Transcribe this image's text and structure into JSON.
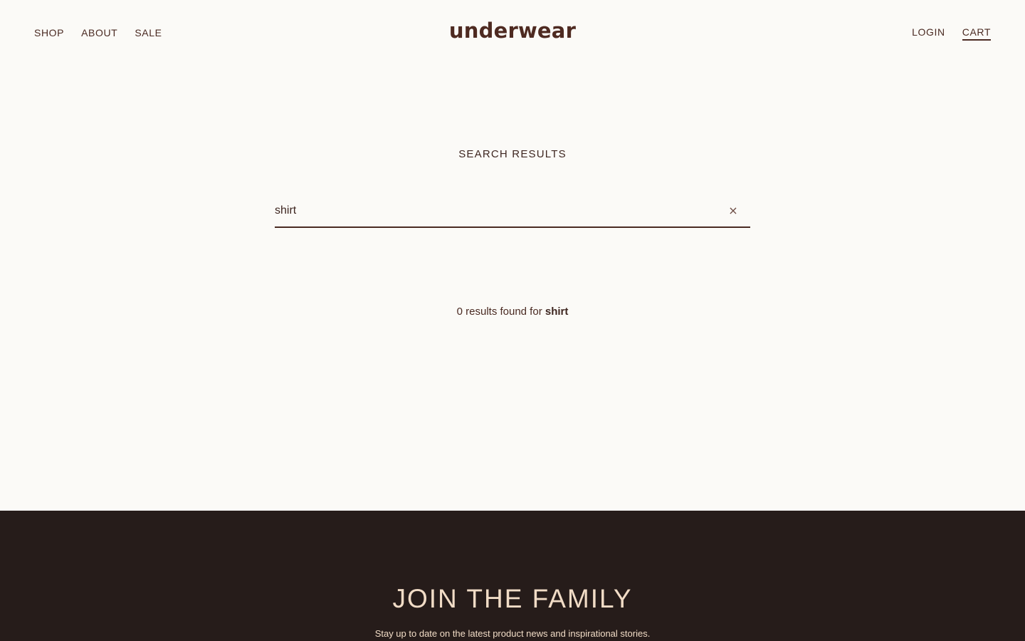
{
  "header": {
    "nav_left": [
      {
        "label": "SHOP"
      },
      {
        "label": "ABOUT"
      },
      {
        "label": "SALE"
      }
    ],
    "logo": "underwear",
    "nav_right": [
      {
        "label": "LOGIN"
      },
      {
        "label": "CART"
      }
    ]
  },
  "main": {
    "title": "SEARCH RESULTS",
    "search": {
      "value": "shirt",
      "placeholder": "",
      "clear_icon": "close-icon",
      "clear_glyph": "×"
    },
    "results": {
      "prefix": "0 results found for ",
      "query": "shirt"
    }
  },
  "footer": {
    "title": "JOIN THE FAMILY",
    "subtitle": "Stay up to date on the latest product news and inspirational stories."
  },
  "colors": {
    "background": "#fbfaf7",
    "text": "#4a2a22",
    "footer_bg": "#261c1a",
    "footer_text": "#f1dcc6"
  }
}
